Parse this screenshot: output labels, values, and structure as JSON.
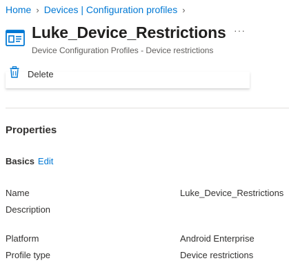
{
  "breadcrumb": [
    {
      "label": "Home"
    },
    {
      "label": "Devices | Configuration profiles"
    }
  ],
  "header": {
    "title": "Luke_Device_Restrictions",
    "subtitle": "Device Configuration Profiles - Device restrictions",
    "more": "···"
  },
  "commands": {
    "delete": "Delete"
  },
  "properties": {
    "heading": "Properties",
    "basics": {
      "label": "Basics",
      "edit": "Edit"
    },
    "rows": [
      {
        "label": "Name",
        "value": "Luke_Device_Restrictions"
      },
      {
        "label": "Description",
        "value": ""
      },
      {
        "label": "Platform",
        "value": "Android Enterprise"
      },
      {
        "label": "Profile type",
        "value": "Device restrictions"
      }
    ]
  },
  "colors": {
    "accent": "#0078d4",
    "text": "#323130",
    "muted": "#605e5c"
  },
  "icons": {
    "header": "configuration-profile-icon",
    "delete": "trash-icon",
    "separator": "chevron-right-icon"
  }
}
